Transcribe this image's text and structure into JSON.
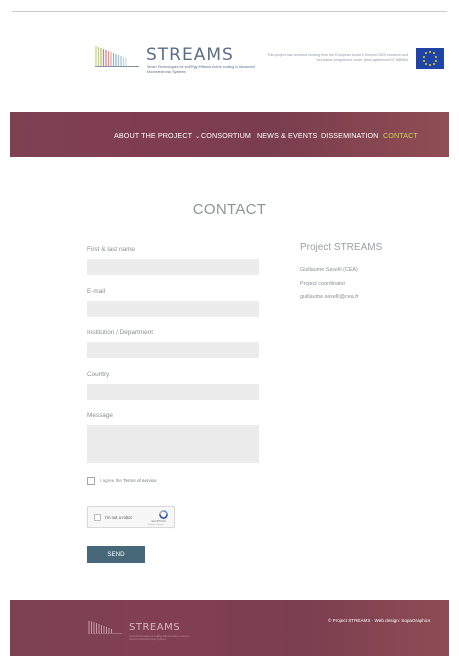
{
  "header": {
    "logo_title": "STREAMS",
    "logo_subtitle": "Smart Technologies for enERgy Efficient Active cooling in Advanced Microelectronic Systems",
    "eu_funding_text": "This project has received funding from the European Union's Horizon 2020 research and innovation programme under grant agreement N° 688564",
    "flag_color": "#1f44a8"
  },
  "nav": {
    "items": [
      {
        "label": "ABOUT THE PROJECT",
        "has_dropdown": true
      },
      {
        "label": "CONSORTIUM"
      },
      {
        "label": "NEWS & EVENTS"
      },
      {
        "label": "DISSEMINATION"
      },
      {
        "label": "CONTACT",
        "active": true
      }
    ],
    "dropdown_icon": "chevron-down-icon",
    "active_color": "#c8d35a"
  },
  "page": {
    "title": "CONTACT"
  },
  "form": {
    "fields": [
      {
        "label": "First & last name",
        "value": ""
      },
      {
        "label": "E-mail",
        "value": ""
      },
      {
        "label": "Institution / Department",
        "value": ""
      },
      {
        "label": "Country",
        "value": ""
      },
      {
        "label": "Message",
        "value": ""
      }
    ],
    "agree_prefix": "I agree the ",
    "agree_link": "Terms of service",
    "captcha_label": "I'm not a robot",
    "captcha_brand": "reCAPTCHA",
    "captcha_privacy": "Privacy - Terms",
    "submit_label": "SEND",
    "submit_color": "#466878"
  },
  "sidebar": {
    "title": "Project STREAMS",
    "name": "Guillaume Savelli (CEA)",
    "role": "Project coordinator",
    "email": "guillaume.savelli@cea.fr"
  },
  "footer": {
    "logo_title": "STREAMS",
    "logo_subtitle": "Smart Technologies for enERgy Efficient Active cooling in Advanced Microelectronic Systems",
    "copyright": "© Project STREAMS · Web design: SopaGraphics"
  }
}
